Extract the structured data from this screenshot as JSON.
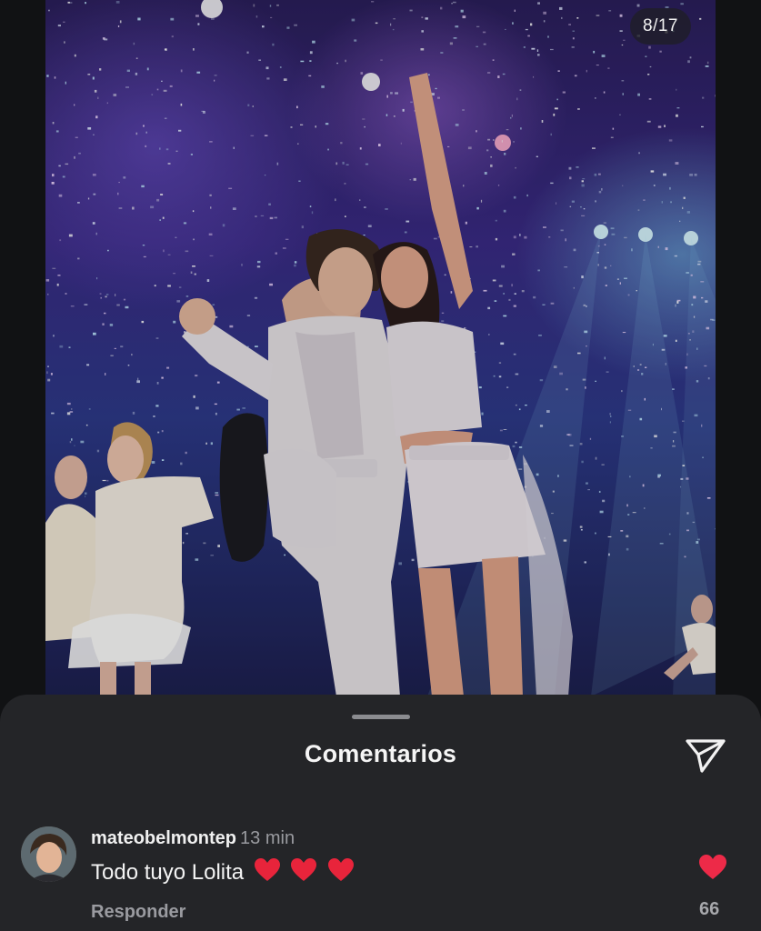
{
  "carousel": {
    "position_label": "8/17"
  },
  "sheet": {
    "title": "Comentarios"
  },
  "comment": {
    "username": "mateobelmontep",
    "time": "13 min",
    "text": "Todo tuyo Lolita",
    "emojis": [
      "red-heart",
      "red-heart",
      "red-heart"
    ],
    "reply_label": "Responder",
    "like_count": "66",
    "liked": true
  },
  "colors": {
    "sheet_bg": "#242528",
    "like_red": "#ed2a48",
    "muted_text": "#9a9ba0"
  },
  "icons": [
    "send-icon",
    "like-heart-icon",
    "avatar"
  ]
}
